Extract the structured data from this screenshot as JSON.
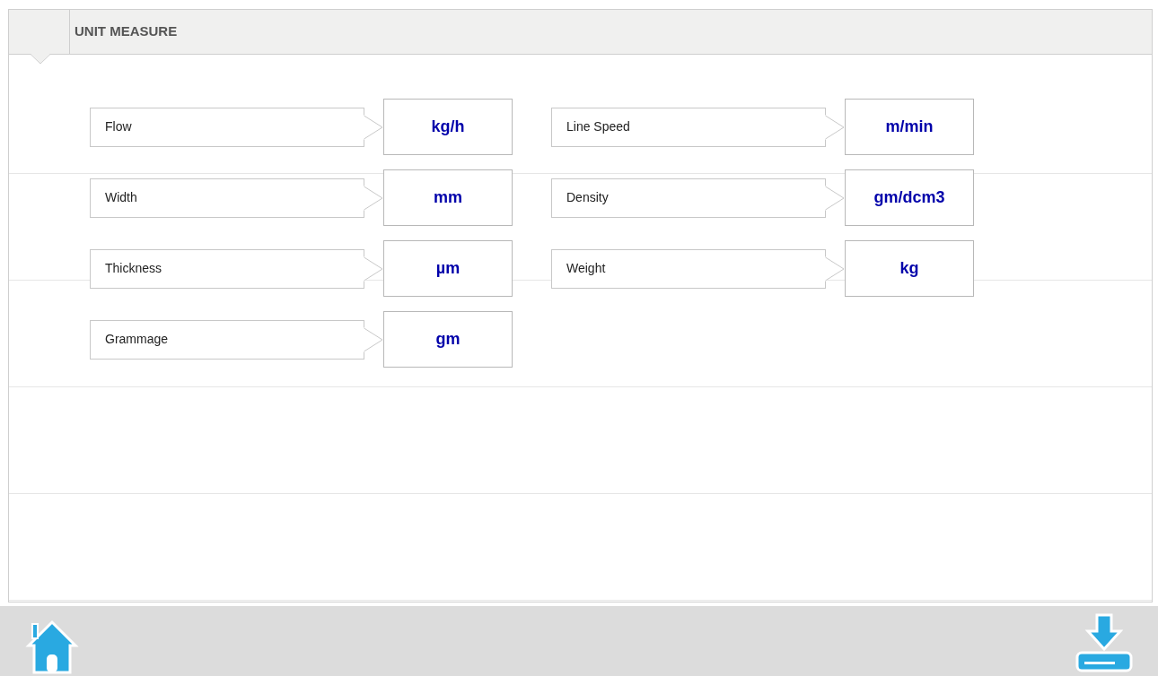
{
  "header": {
    "title": "UNIT MEASURE"
  },
  "columns": [
    {
      "rows": [
        {
          "label": "Flow",
          "unit": "kg/h"
        },
        {
          "label": "Width",
          "unit": "mm"
        },
        {
          "label": "Thickness",
          "unit": "µm"
        },
        {
          "label": "Grammage",
          "unit": "gm"
        }
      ]
    },
    {
      "rows": [
        {
          "label": "Line Speed",
          "unit": "m/min"
        },
        {
          "label": "Density",
          "unit": "gm/dcm3"
        },
        {
          "label": "Weight",
          "unit": "kg"
        }
      ]
    }
  ]
}
